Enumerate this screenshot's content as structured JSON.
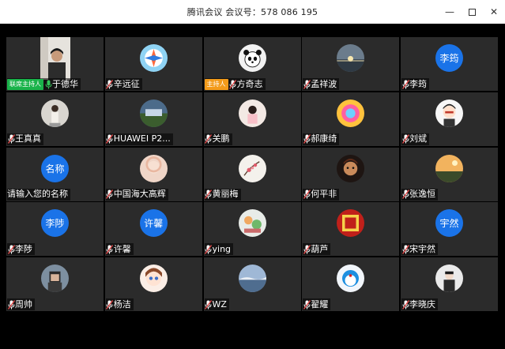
{
  "window": {
    "title": "腾讯会议 会议号：578 086 195"
  },
  "colors": {
    "tile_bg": "#2b2b2b",
    "stage_bg": "#000000",
    "text_avatar": "#1a73e8",
    "cohost_badge": "#19b34a",
    "host_badge": "#f39b1a",
    "mic_muted": "#e24b4b",
    "mic_active": "#33c759"
  },
  "participants": [
    {
      "name": "于德华",
      "badge": "联席主持人",
      "mic": "active",
      "avatar": "video"
    },
    {
      "name": "辛远征",
      "mic": "muted",
      "avatar": "image"
    },
    {
      "name": "方奇志",
      "badge": "主持人",
      "mic": "muted",
      "avatar": "image"
    },
    {
      "name": "孟祥波",
      "mic": "muted",
      "avatar": "image"
    },
    {
      "name": "李筠",
      "mic": "muted",
      "avatar": "text",
      "avatar_text": "李筠"
    },
    {
      "name": "王真真",
      "mic": "muted",
      "avatar": "image"
    },
    {
      "name": "HUAWEI P2...",
      "mic": "muted",
      "avatar": "image"
    },
    {
      "name": "关鹏",
      "mic": "muted",
      "avatar": "image"
    },
    {
      "name": "郝康绮",
      "mic": "muted",
      "avatar": "image"
    },
    {
      "name": "刘斌",
      "mic": "muted",
      "avatar": "image"
    },
    {
      "name": "请输入您的名称",
      "mic": "none",
      "avatar": "text",
      "avatar_text": "名称"
    },
    {
      "name": "中国海大高辉",
      "mic": "muted",
      "avatar": "image"
    },
    {
      "name": "黄丽梅",
      "mic": "muted",
      "avatar": "image"
    },
    {
      "name": "何平非",
      "mic": "muted",
      "avatar": "image"
    },
    {
      "name": "张逸恒",
      "mic": "muted",
      "avatar": "image"
    },
    {
      "name": "李陟",
      "mic": "muted",
      "avatar": "text",
      "avatar_text": "李陟"
    },
    {
      "name": "许馨",
      "mic": "muted",
      "avatar": "text",
      "avatar_text": "许馨"
    },
    {
      "name": "ying",
      "mic": "muted",
      "avatar": "image"
    },
    {
      "name": "葫芦",
      "mic": "muted",
      "avatar": "image"
    },
    {
      "name": "宋宇然",
      "mic": "muted",
      "avatar": "text",
      "avatar_text": "宇然"
    },
    {
      "name": "周帅",
      "mic": "muted",
      "avatar": "image"
    },
    {
      "name": "杨洁",
      "mic": "muted",
      "avatar": "image"
    },
    {
      "name": "WZ",
      "mic": "muted",
      "avatar": "image"
    },
    {
      "name": "翟耀",
      "mic": "muted",
      "avatar": "image"
    },
    {
      "name": "李晓庆",
      "mic": "muted",
      "avatar": "image"
    }
  ]
}
